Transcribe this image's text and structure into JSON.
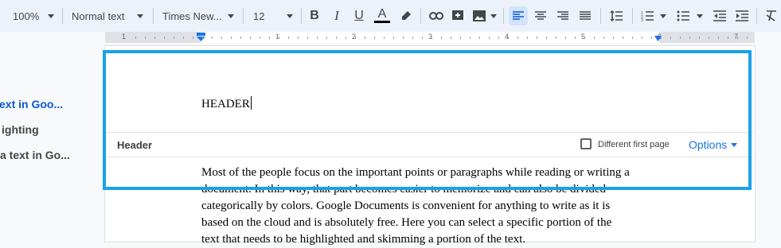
{
  "toolbar": {
    "zoom": "100%",
    "style": "Normal text",
    "font": "Times New...",
    "size": "12",
    "bold": "B",
    "italic": "I",
    "underline": "U",
    "text_color_letter": "A",
    "text_color_swatch": "#000000"
  },
  "ruler": {
    "numbers": [
      "1",
      "1",
      "2",
      "3",
      "4",
      "5",
      "6",
      "7"
    ]
  },
  "outline": {
    "items": [
      {
        "label": "ext in Goo...",
        "active": true
      },
      {
        "label": "ighting",
        "active": false
      },
      {
        "label": "a text in Go...",
        "active": false
      }
    ]
  },
  "document": {
    "header_text": "HEADER",
    "header_bar": {
      "label": "Header",
      "different_first_page": "Different first page",
      "options": "Options"
    },
    "body_lines": [
      "Most of the people focus on the important points or paragraphs while reading or writing a",
      "document. In this way, that part becomes easier to memorize and can also be divided",
      "categorically by colors. Google Documents is convenient for anything to write as it is",
      "based on the cloud and is absolutely free. Here you can select a specific portion of the",
      "text that needs to be highlighted and skimming a portion of the text."
    ]
  },
  "colors": {
    "highlight_frame": "#1aa1e6",
    "accent": "#1a73e8",
    "toolbar_bg": "#edf2fa"
  }
}
